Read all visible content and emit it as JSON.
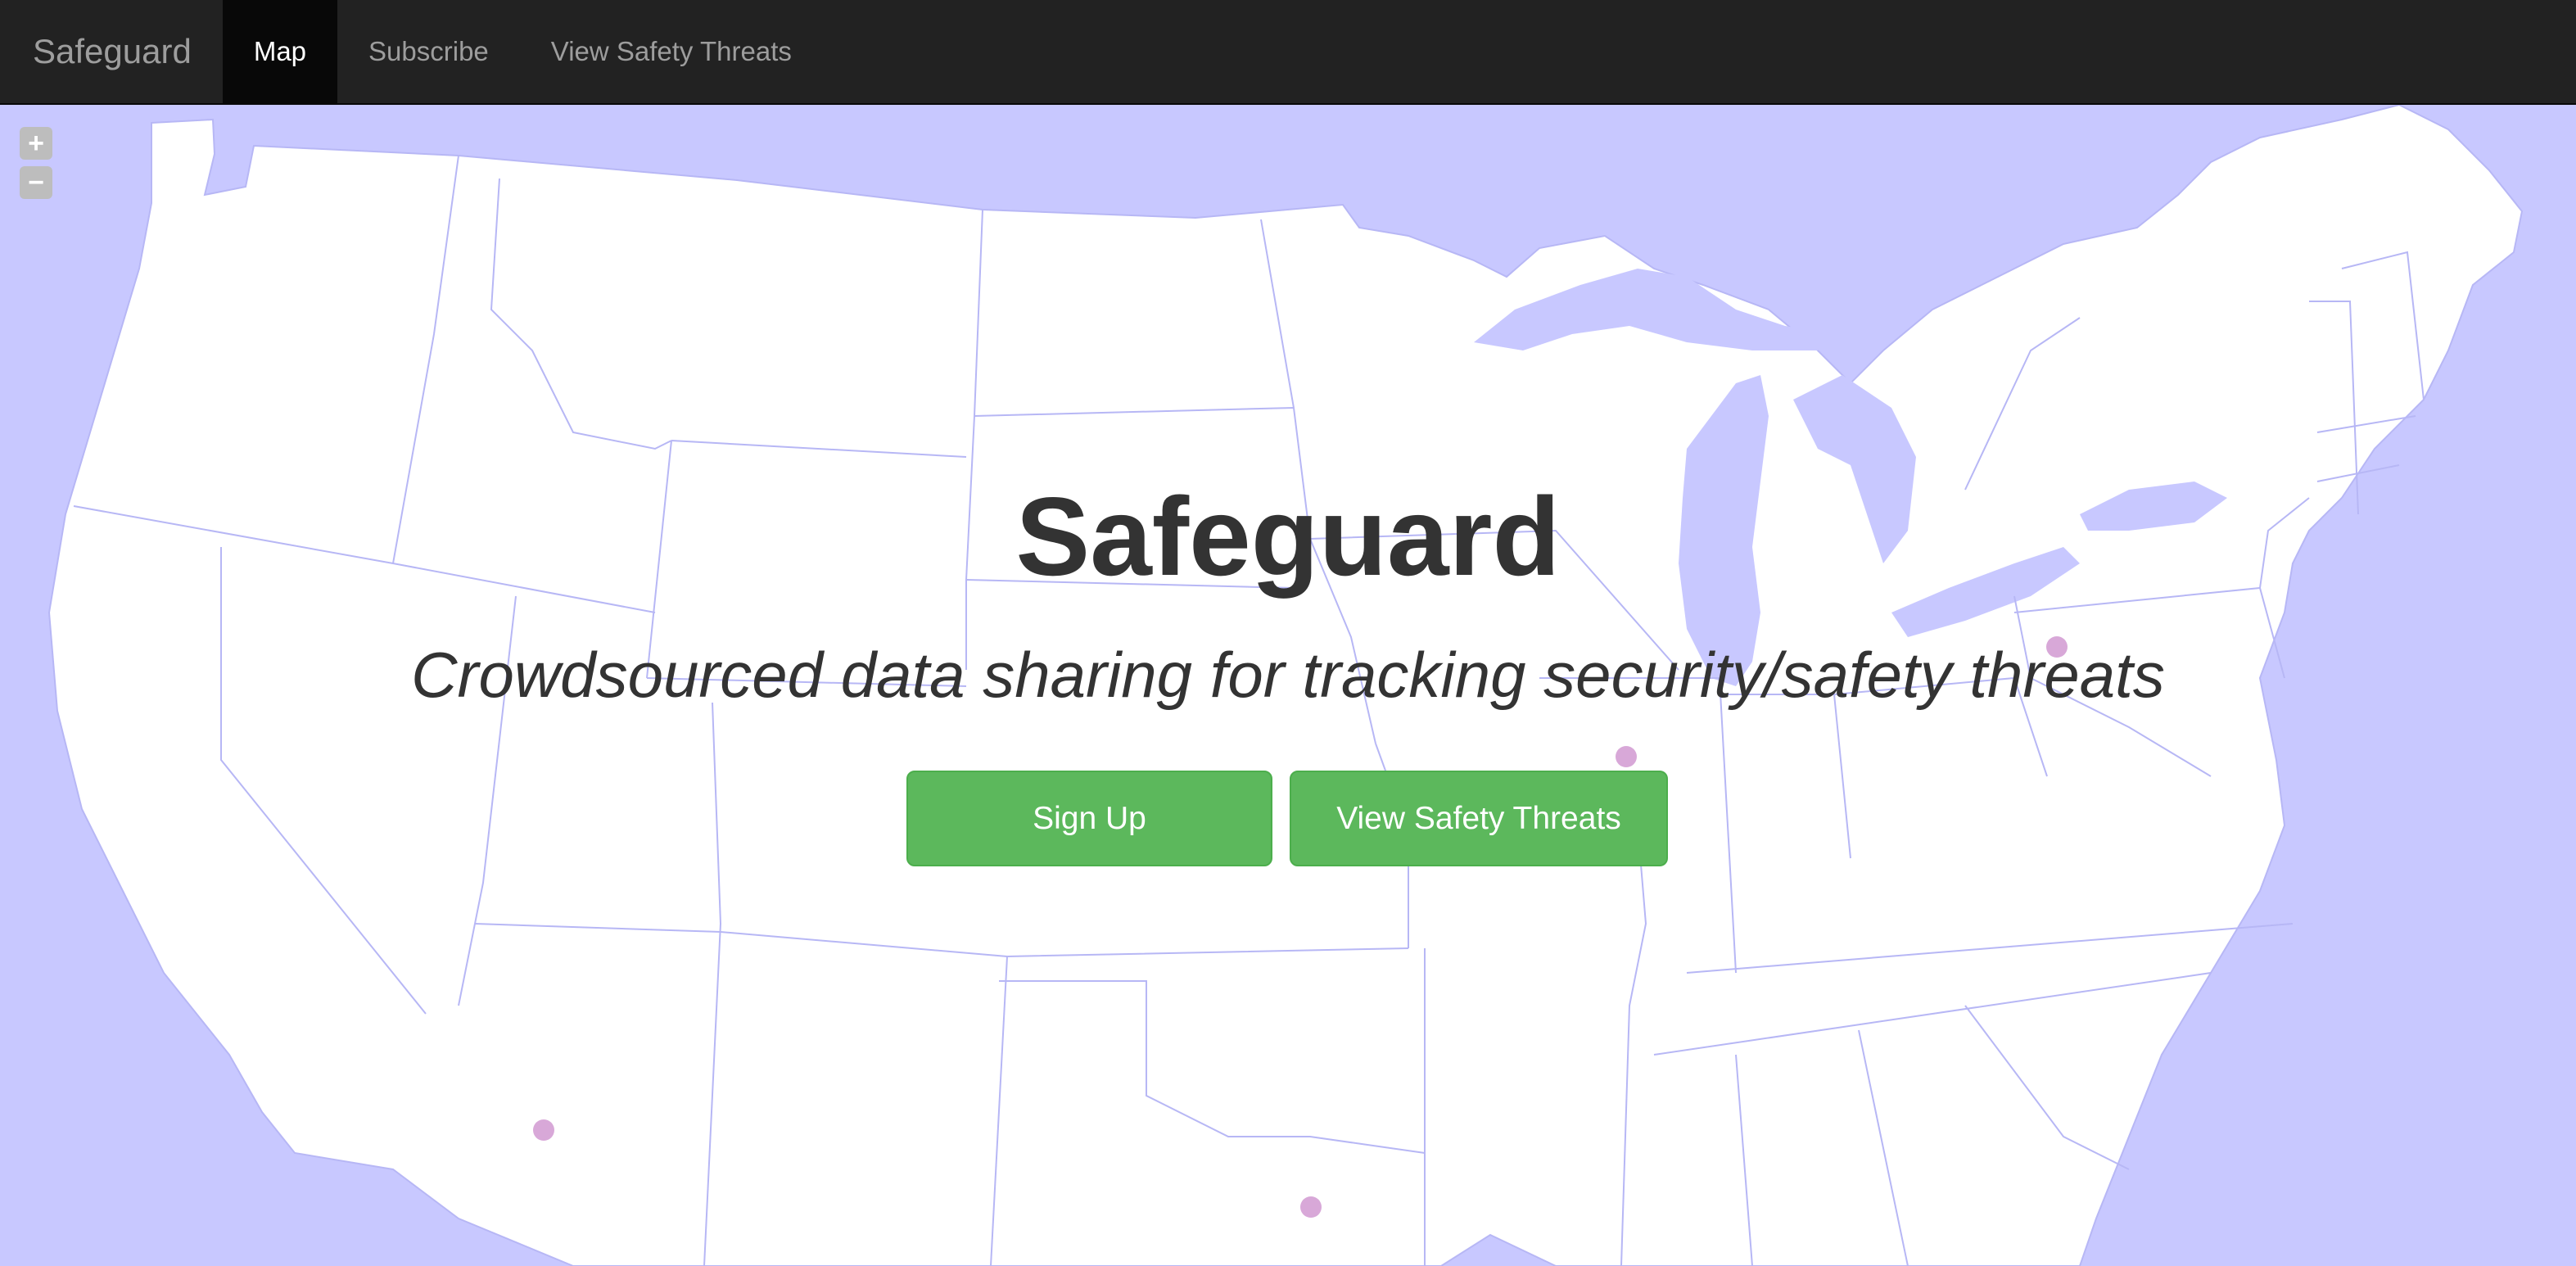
{
  "navbar": {
    "brand": "Safeguard",
    "items": [
      {
        "label": "Map",
        "active": true
      },
      {
        "label": "Subscribe",
        "active": false
      },
      {
        "label": "View Safety Threats",
        "active": false
      }
    ]
  },
  "map": {
    "zoom_in": "+",
    "zoom_out": "−",
    "water_color": "#c8c8ff",
    "land_color": "#ffffff",
    "border_color": "#b7b7f5",
    "marker_color": "#d8a8d8"
  },
  "hero": {
    "title": "Safeguard",
    "subtitle": "Crowdsourced data sharing for tracking security/safety threats",
    "signup_label": "Sign Up",
    "threats_label": "View Safety Threats"
  }
}
